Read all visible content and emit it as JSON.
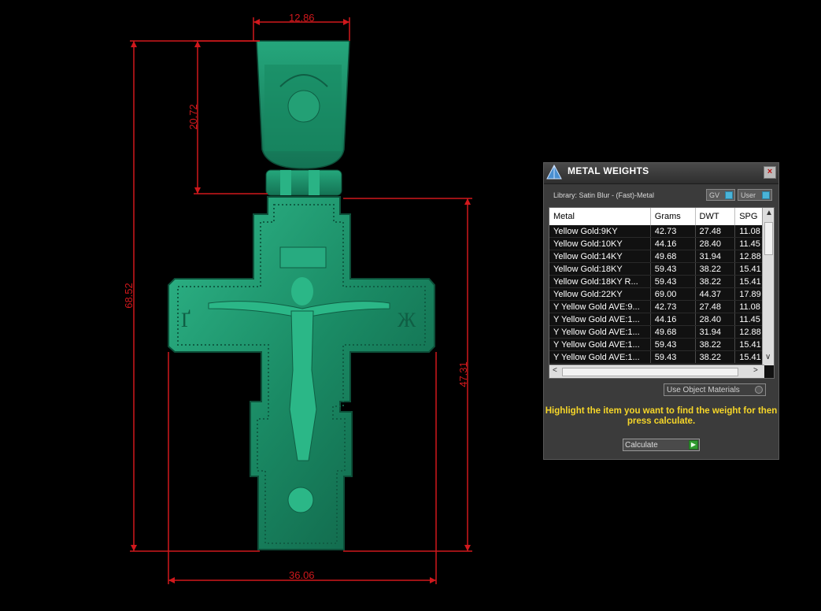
{
  "dimensions": {
    "top_width": "12.86",
    "bail_height": "20.72",
    "total_height": "68.52",
    "cross_height": "47.31",
    "bottom_width": "36.06"
  },
  "panel": {
    "title": "METAL WEIGHTS",
    "close_symbol": "×",
    "library": "Library: Satin Blur - (Fast)-Metal",
    "toggles": {
      "gv": "GV",
      "user": "User"
    },
    "columns": [
      "Metal",
      "Grams",
      "DWT",
      "SPG"
    ],
    "rows": [
      {
        "metal": "Yellow Gold:9KY",
        "grams": "42.73",
        "dwt": "27.48",
        "spg": "11.08"
      },
      {
        "metal": "Yellow Gold:10KY",
        "grams": "44.16",
        "dwt": "28.40",
        "spg": "11.45"
      },
      {
        "metal": "Yellow Gold:14KY",
        "grams": "49.68",
        "dwt": "31.94",
        "spg": "12.88"
      },
      {
        "metal": "Yellow Gold:18KY",
        "grams": "59.43",
        "dwt": "38.22",
        "spg": "15.41"
      },
      {
        "metal": "Yellow Gold:18KY R...",
        "grams": "59.43",
        "dwt": "38.22",
        "spg": "15.41"
      },
      {
        "metal": "Yellow Gold:22KY",
        "grams": "69.00",
        "dwt": "44.37",
        "spg": "17.89"
      },
      {
        "metal": "Y Yellow Gold AVE:9...",
        "grams": "42.73",
        "dwt": "27.48",
        "spg": "11.08"
      },
      {
        "metal": "Y Yellow Gold AVE:1...",
        "grams": "44.16",
        "dwt": "28.40",
        "spg": "11.45"
      },
      {
        "metal": "Y Yellow Gold AVE:1...",
        "grams": "49.68",
        "dwt": "31.94",
        "spg": "12.88"
      },
      {
        "metal": "Y Yellow Gold AVE:1...",
        "grams": "59.43",
        "dwt": "38.22",
        "spg": "15.41"
      },
      {
        "metal": "Y Yellow Gold AVE:1...",
        "grams": "59.43",
        "dwt": "38.22",
        "spg": "15.41"
      }
    ],
    "use_object_materials": "Use Object Materials",
    "hint": "Highlight the item you want to find the weight for then press calculate.",
    "calculate": "Calculate",
    "scroll_icons": {
      "up": "▲",
      "down": "∨",
      "left": "<",
      "right": ">"
    },
    "go_icon": "▶"
  },
  "colors": {
    "dimension_lines": "#d0181c",
    "model": "#1f8f6a",
    "hint_text": "#f6d629"
  }
}
